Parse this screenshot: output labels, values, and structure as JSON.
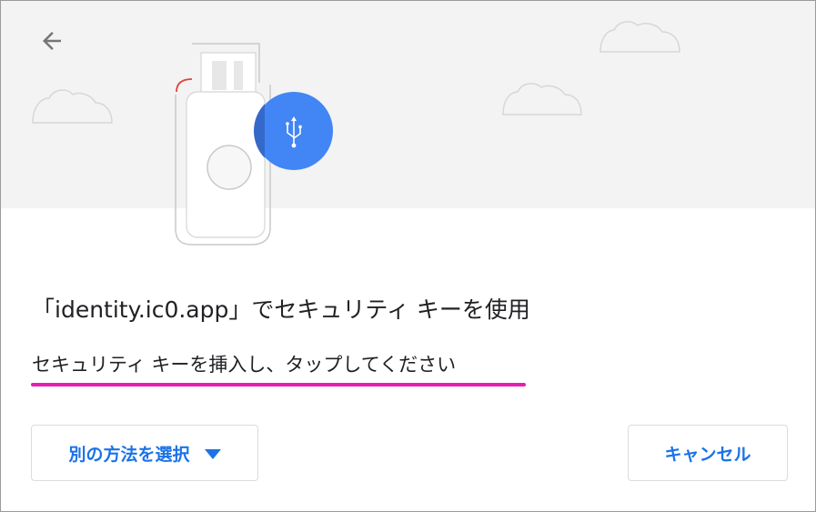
{
  "dialog": {
    "title": "「identity.ic0.app」でセキュリティ キーを使用",
    "instruction": "セキュリティ キーを挿入し、タップしてください"
  },
  "buttons": {
    "choose_method": "別の方法を選択",
    "cancel": "キャンセル"
  },
  "icons": {
    "back": "back-arrow-icon",
    "usb": "usb-icon",
    "dropdown": "caret-down-icon"
  },
  "colors": {
    "accent": "#1a73e8",
    "usb_circle": "#4285f4",
    "highlight_underline": "#e81cb3"
  }
}
